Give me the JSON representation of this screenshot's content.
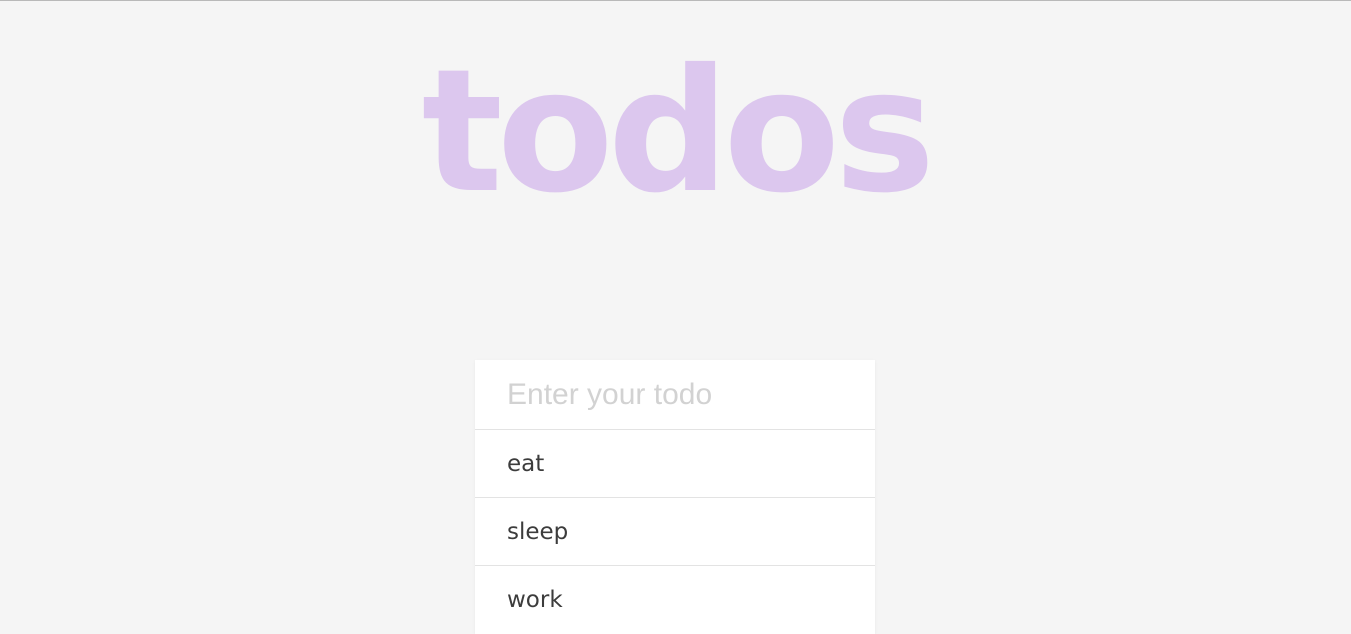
{
  "header": {
    "title": "todos",
    "title_color": "#dcc7ee"
  },
  "new_todo": {
    "placeholder": "Enter your todo",
    "value": ""
  },
  "todos": [
    {
      "label": "eat"
    },
    {
      "label": "sleep"
    },
    {
      "label": "work"
    }
  ],
  "colors": {
    "background": "#f5f5f5",
    "card": "#ffffff",
    "divider": "#e3e3e3",
    "text": "#3c3c3c",
    "placeholder": "#d2d2d2"
  }
}
